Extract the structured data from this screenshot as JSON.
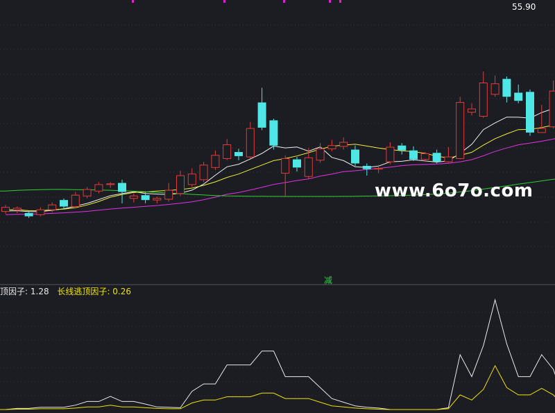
{
  "chart_data": [
    {
      "type": "candlestick",
      "candle_width": 12,
      "y_range": [
        25,
        60
      ],
      "up_color": "#e23b3b",
      "down_color": "#4fe6e6",
      "high_label": "55.90",
      "candles": [
        [
          34.0,
          34.5,
          34.8,
          33.7
        ],
        [
          34.2,
          34.4,
          34.6,
          33.8
        ],
        [
          33.8,
          33.4,
          34.1,
          33.2
        ],
        [
          33.6,
          34.2,
          34.5,
          33.4
        ],
        [
          34.2,
          34.8,
          35.1,
          33.9
        ],
        [
          35.4,
          34.6,
          35.6,
          34.3
        ],
        [
          34.6,
          36.0,
          36.4,
          34.4
        ],
        [
          35.9,
          36.7,
          37.0,
          35.6
        ],
        [
          36.5,
          37.3,
          37.6,
          36.2
        ],
        [
          37.3,
          37.4,
          37.6,
          36.9
        ],
        [
          37.5,
          36.4,
          37.9,
          35.0
        ],
        [
          35.6,
          35.9,
          36.2,
          35.1
        ],
        [
          36.0,
          35.4,
          36.4,
          35.0
        ],
        [
          35.4,
          35.6,
          35.8,
          35.0
        ],
        [
          35.5,
          36.6,
          37.5,
          35.2
        ],
        [
          36.2,
          38.4,
          39.0,
          35.9
        ],
        [
          37.3,
          38.6,
          39.3,
          37.0
        ],
        [
          37.9,
          39.7,
          40.1,
          37.6
        ],
        [
          39.4,
          40.9,
          41.5,
          39.1
        ],
        [
          40.5,
          42.2,
          42.9,
          40.3
        ],
        [
          41.3,
          40.8,
          41.7,
          40.3
        ],
        [
          40.7,
          44.2,
          45.0,
          40.5
        ],
        [
          47.4,
          44.3,
          49.2,
          44.0
        ],
        [
          45.2,
          42.1,
          45.4,
          41.6
        ],
        [
          38.7,
          40.5,
          40.9,
          35.9
        ],
        [
          40.4,
          39.4,
          40.7,
          38.9
        ],
        [
          38.3,
          40.6,
          41.8,
          38.0
        ],
        [
          40.3,
          41.7,
          42.4,
          40.0
        ],
        [
          41.7,
          42.1,
          42.8,
          41.4
        ],
        [
          42.0,
          42.5,
          43.1,
          41.6
        ],
        [
          41.6,
          39.9,
          42.1,
          39.6
        ],
        [
          39.6,
          39.2,
          39.9,
          38.4
        ],
        [
          39.2,
          39.3,
          39.7,
          38.7
        ],
        [
          40.1,
          41.9,
          42.5,
          39.8
        ],
        [
          42.1,
          41.5,
          42.4,
          41.0
        ],
        [
          41.5,
          40.4,
          42.0,
          40.2
        ],
        [
          40.4,
          41.1,
          41.3,
          40.2
        ],
        [
          41.2,
          40.1,
          41.6,
          39.9
        ],
        [
          40.1,
          40.7,
          41.9,
          40.0
        ],
        [
          40.5,
          47.4,
          48.1,
          40.4
        ],
        [
          46.2,
          46.6,
          47.3,
          45.8
        ],
        [
          45.7,
          49.8,
          51.2,
          45.5
        ],
        [
          48.4,
          49.7,
          50.7,
          48.1
        ],
        [
          50.3,
          48.1,
          50.6,
          47.4
        ],
        [
          48.6,
          47.6,
          49.6,
          47.3
        ],
        [
          48.7,
          43.7,
          49.0,
          43.3
        ],
        [
          43.7,
          44.2,
          47.1,
          44.1
        ],
        [
          44.4,
          48.8,
          50.1,
          44.2
        ],
        [
          48.3,
          48.8,
          50.3,
          48.0
        ],
        [
          48.5,
          47.6,
          49.8,
          47.4
        ],
        [
          46.5,
          48.4,
          49.1,
          44.2
        ],
        [
          47.0,
          51.4,
          55.7,
          46.8
        ],
        [
          51.3,
          53.7,
          55.9,
          51.0
        ],
        [
          54.5,
          52.0,
          54.9,
          51.5
        ],
        [
          52.5,
          50.7,
          52.9,
          50.4
        ],
        [
          51.0,
          50.6,
          51.2,
          49.9
        ],
        [
          49.3,
          45.4,
          49.5,
          45.3
        ]
      ],
      "ma_lines": [
        {
          "color": "#f0f0f0",
          "values": [
            34.05,
            34.08,
            33.97,
            33.97,
            34.13,
            34.33,
            34.65,
            34.99,
            35.46,
            35.94,
            36.19,
            36.41,
            36.21,
            36.13,
            36.06,
            36.23,
            36.62,
            37.36,
            38.45,
            39.49,
            39.8,
            40.44,
            41.13,
            42.04,
            41.81,
            41.92,
            41.4,
            41.94,
            40.64,
            40.25,
            39.49,
            39.41,
            39.57,
            40.1,
            40.16,
            40.36,
            40.2,
            40.07,
            40.21,
            41.15,
            42.25,
            44.06,
            44.88,
            45.6,
            45.58,
            45.47,
            46.16,
            46.65,
            46.64,
            46.1,
            46.4,
            48.2,
            49.2,
            49.92,
            50.02,
            50.1,
            49.52
          ]
        },
        {
          "color": "#f2ee3a",
          "values": [
            34.2,
            34.22,
            34.09,
            34.08,
            34.21,
            34.29,
            34.45,
            34.79,
            35.21,
            35.76,
            36.07,
            36.33,
            36.39,
            36.51,
            36.58,
            36.69,
            36.87,
            37.21,
            37.63,
            38.18,
            38.6,
            39.15,
            39.7,
            40.25,
            40.5,
            40.82,
            41.23,
            41.65,
            42.02,
            42.15,
            42.27,
            42.04,
            41.8,
            41.6,
            41.45,
            41.36,
            41.13,
            40.8,
            40.56,
            40.89,
            41.27,
            42.15,
            42.94,
            43.53,
            44.06,
            44.09,
            44.32,
            44.62,
            44.82,
            44.99,
            45.08,
            45.54,
            45.99,
            46.58,
            46.95,
            47.22,
            47.16
          ]
        },
        {
          "color": "#e233e2",
          "values": [
            33.6,
            33.65,
            33.66,
            33.7,
            33.76,
            33.83,
            33.91,
            34.01,
            34.16,
            34.3,
            34.41,
            34.51,
            34.62,
            34.72,
            34.86,
            35.01,
            35.18,
            35.44,
            35.76,
            36.11,
            36.32,
            36.63,
            36.96,
            37.32,
            37.55,
            37.8,
            38.0,
            38.33,
            38.6,
            38.89,
            39.0,
            39.15,
            39.29,
            39.45,
            39.63,
            39.73,
            39.77,
            39.83,
            39.91,
            40.1,
            40.37,
            40.84,
            41.37,
            41.8,
            42.19,
            42.41,
            42.63,
            42.9,
            43.19,
            43.47,
            43.77,
            44.26,
            44.72,
            45.22,
            45.62,
            46.0,
            46.22
          ]
        },
        {
          "color": "#2fd12f",
          "values": [
            36.5,
            36.58,
            36.64,
            36.68,
            36.7,
            36.7,
            36.68,
            36.66,
            36.63,
            36.6,
            36.55,
            36.49,
            36.42,
            36.34,
            36.26,
            36.18,
            36.1,
            36.02,
            35.95,
            35.9,
            35.88,
            35.87,
            35.86,
            35.85,
            35.84,
            35.84,
            35.84,
            35.84,
            35.84,
            35.85,
            35.86,
            35.88,
            35.9,
            35.93,
            35.96,
            36.0,
            36.06,
            36.14,
            36.25,
            36.4,
            36.55,
            36.75,
            36.95,
            37.15,
            37.35,
            37.55,
            37.75,
            37.95,
            38.12,
            38.28,
            38.42,
            38.58,
            38.75,
            38.95,
            39.17,
            39.43,
            39.7
          ]
        }
      ],
      "signal_label": "减"
    },
    {
      "type": "line",
      "y_range": [
        0,
        3.0
      ],
      "series": [
        {
          "name": "顶因子",
          "color": "#e9e9e9",
          "current_value": "1.28",
          "values": [
            0.0,
            0.03,
            0.03,
            0.06,
            0.06,
            0.06,
            0.12,
            0.22,
            0.22,
            0.36,
            0.22,
            0.22,
            0.15,
            0.07,
            0.06,
            0.05,
            0.5,
            0.7,
            0.7,
            1.22,
            1.22,
            1.22,
            1.6,
            1.6,
            0.9,
            0.9,
            0.9,
            0.6,
            0.3,
            0.2,
            0.1,
            0.06,
            0.04,
            0.0,
            0.0,
            0.0,
            0.0,
            0.0,
            0.05,
            1.5,
            0.9,
            1.75,
            3.0,
            1.8,
            0.9,
            0.9,
            1.5,
            1.1,
            0.2,
            0.2,
            3.0,
            3.0,
            1.7,
            0.9,
            0.8,
            0.4,
            0.1
          ]
        },
        {
          "name": "长线逃顶因子",
          "color": "#f0e400",
          "current_value": "0.26",
          "values": [
            0.0,
            0.01,
            0.01,
            0.02,
            0.02,
            0.02,
            0.04,
            0.07,
            0.07,
            0.12,
            0.07,
            0.07,
            0.05,
            0.03,
            0.02,
            0.02,
            0.18,
            0.26,
            0.26,
            0.35,
            0.35,
            0.35,
            0.45,
            0.45,
            0.3,
            0.3,
            0.3,
            0.2,
            0.1,
            0.07,
            0.04,
            0.02,
            0.01,
            0.0,
            0.0,
            0.0,
            0.0,
            0.0,
            0.02,
            0.4,
            0.26,
            0.55,
            1.2,
            0.6,
            0.4,
            0.4,
            0.58,
            0.4,
            0.06,
            0.06,
            1.2,
            1.2,
            0.58,
            0.32,
            0.28,
            0.14,
            0.04
          ]
        }
      ]
    }
  ],
  "watermark": "www.6o7o.com"
}
